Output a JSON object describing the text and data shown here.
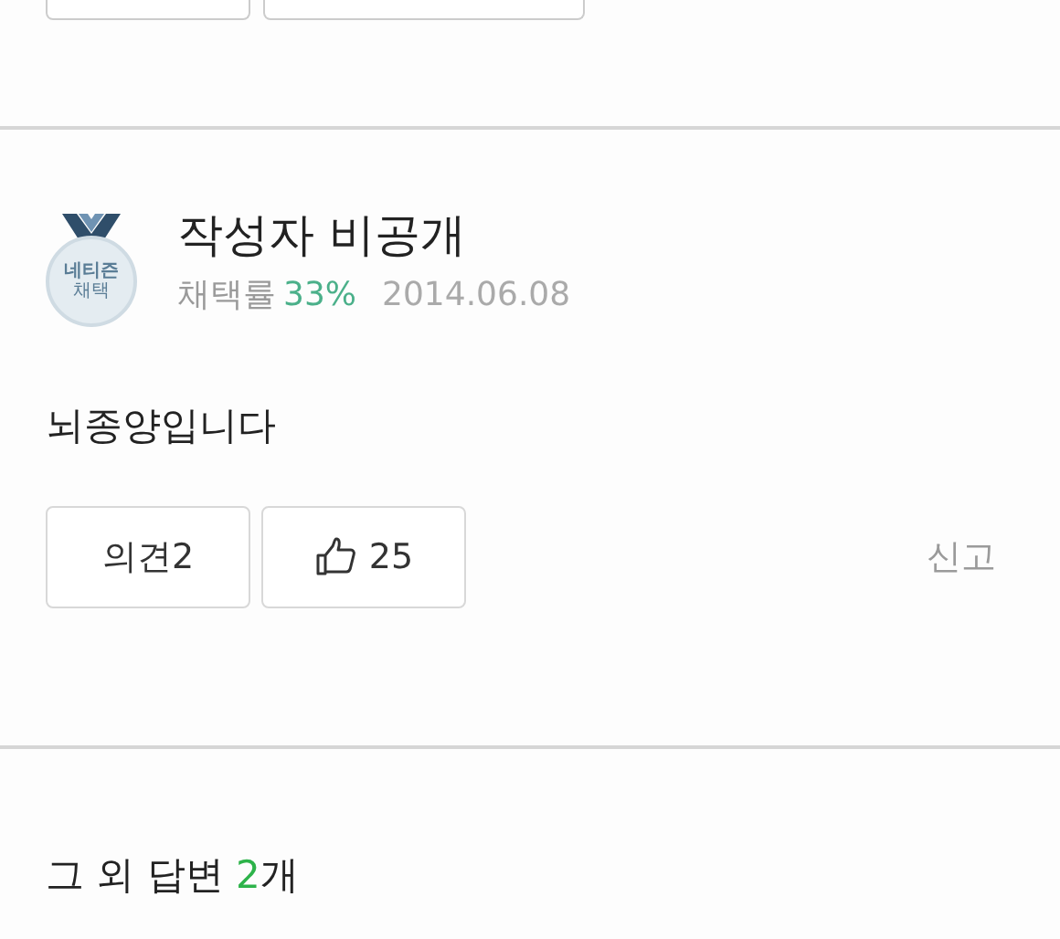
{
  "previous_buttons": [
    {
      "kind": "narrow"
    },
    {
      "kind": "wide"
    }
  ],
  "answer": {
    "author": "작성자 비공개",
    "badge": [
      "네티즌",
      "채택"
    ],
    "adoption_label": "채택률",
    "adoption_rate": "33%",
    "date": "2014.06.08",
    "body": "뇌종양입니다",
    "comments_button": "의견2",
    "like_count": "25",
    "report_link": "신고"
  },
  "other_answers": {
    "prefix": "그 외 답변 ",
    "count": "2",
    "suffix": "개"
  }
}
